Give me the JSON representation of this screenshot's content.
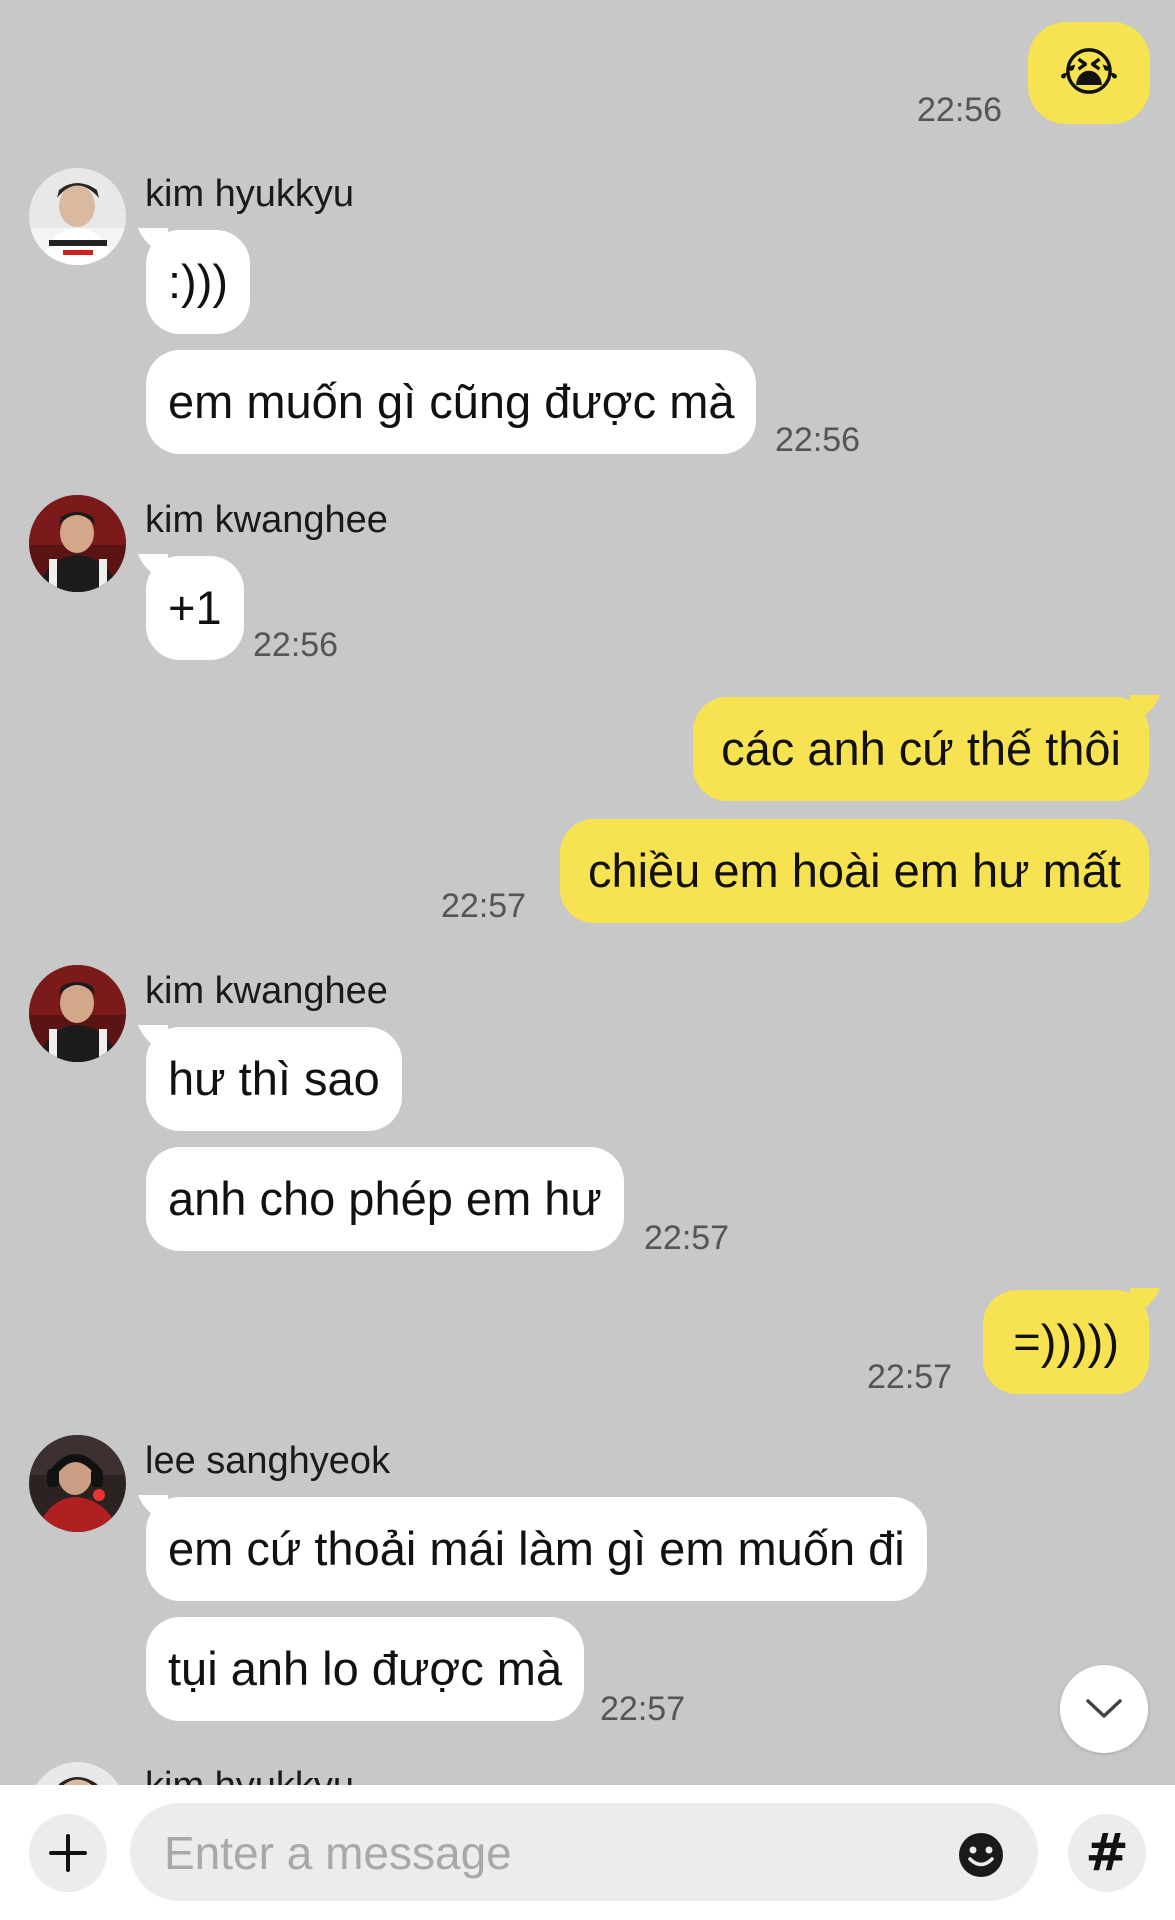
{
  "colors": {
    "background": "#c8c8c8",
    "incoming_bubble": "#ffffff",
    "outgoing_bubble": "#f7e352",
    "timestamp": "#555555"
  },
  "messages": {
    "m0": {
      "emoji": "😭",
      "time": "22:56"
    },
    "m1": {
      "sender": "kim hyukkyu",
      "bubbles": [
        ":)))",
        "em muốn gì cũng được mà"
      ],
      "time": "22:56"
    },
    "m2": {
      "sender": "kim kwanghee",
      "bubbles": [
        "+1"
      ],
      "time": "22:56"
    },
    "m3": {
      "bubbles": [
        "các anh cứ thế thôi",
        "chiều em hoài em hư mất"
      ],
      "time": "22:57"
    },
    "m4": {
      "sender": "kim kwanghee",
      "bubbles": [
        "hư thì sao",
        "anh cho phép em hư"
      ],
      "time": "22:57"
    },
    "m5": {
      "bubbles": [
        "=)))))"
      ],
      "time": "22:57"
    },
    "m6": {
      "sender": "lee sanghyeok",
      "bubbles": [
        "em cứ thoải mái làm gì em muốn đi",
        "tụi anh lo được mà"
      ],
      "time": "22:57"
    },
    "m7": {
      "sender": "kim hyukkyu"
    }
  },
  "input": {
    "placeholder": "Enter a message",
    "plus_icon": "plus-icon",
    "emoji_icon": "smiley-icon",
    "hash_icon": "hash-icon",
    "hash_label": "#"
  },
  "scroll_button": {
    "icon": "chevron-down-icon"
  }
}
